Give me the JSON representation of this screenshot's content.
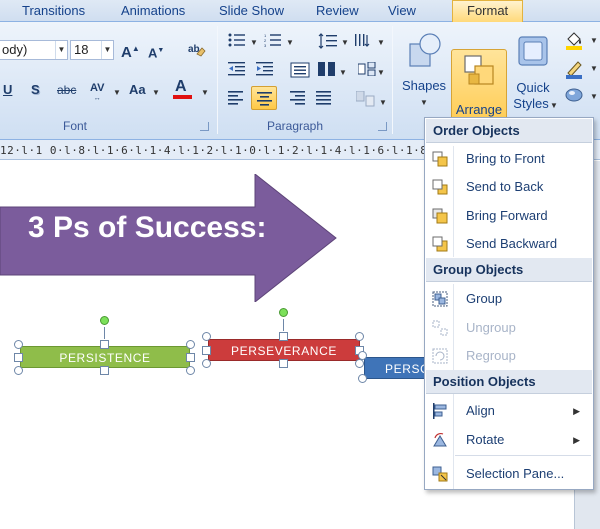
{
  "tabs": {
    "transitions": "Transitions",
    "animations": "Animations",
    "slide_show": "Slide Show",
    "review": "Review",
    "view": "View",
    "format": "Format"
  },
  "font_group": {
    "font_name": "ody)",
    "font_size": "18",
    "grow_font": "A",
    "shrink_font": "A",
    "underline": "U",
    "shadow": "S",
    "strikethrough": "abc",
    "char_spacing": "AV",
    "change_case": "Aa",
    "font_color": "A",
    "font_color_hex": "#e01010",
    "label": "Font"
  },
  "paragraph_group": {
    "label": "Paragraph"
  },
  "drawing_group": {
    "shapes_label": "Shapes",
    "arrange_label": "Arrange",
    "quick_styles_label_1": "Quick",
    "quick_styles_label_2": "Styles"
  },
  "ruler": {
    "text": "12·l·1 0·l·8·l·1·6·l·1·4·l·1·2·l·1·0·l·1·2·l·1·4·l·1·6·l·1·8"
  },
  "slide": {
    "title": "3 Ps of Success:",
    "arrow_color": "#7b5c9c",
    "box1": "PERSISTENCE",
    "box1_color": "#8fbd4a",
    "box2": "PERSEVERANCE",
    "box2_color": "#cc3c3c",
    "box3": "PERSO",
    "box3_color": "#3f74b8"
  },
  "arrange_menu": {
    "order_header": "Order Objects",
    "bring_to_front": "Bring to Front",
    "send_to_back": "Send to Back",
    "bring_forward": "Bring Forward",
    "send_backward": "Send Backward",
    "group_header": "Group Objects",
    "group": "Group",
    "ungroup": "Ungroup",
    "regroup": "Regroup",
    "position_header": "Position Objects",
    "align": "Align",
    "rotate": "Rotate",
    "selection_pane": "Selection Pane..."
  },
  "icons": {
    "bring_to_front": "bring-to-front-icon",
    "send_to_back": "send-to-back-icon",
    "bring_forward": "bring-forward-icon",
    "send_backward": "send-backward-icon",
    "group": "group-icon",
    "ungroup": "ungroup-icon",
    "regroup": "regroup-icon",
    "align": "align-icon",
    "rotate": "rotate-icon",
    "selection_pane": "selection-pane-icon"
  }
}
